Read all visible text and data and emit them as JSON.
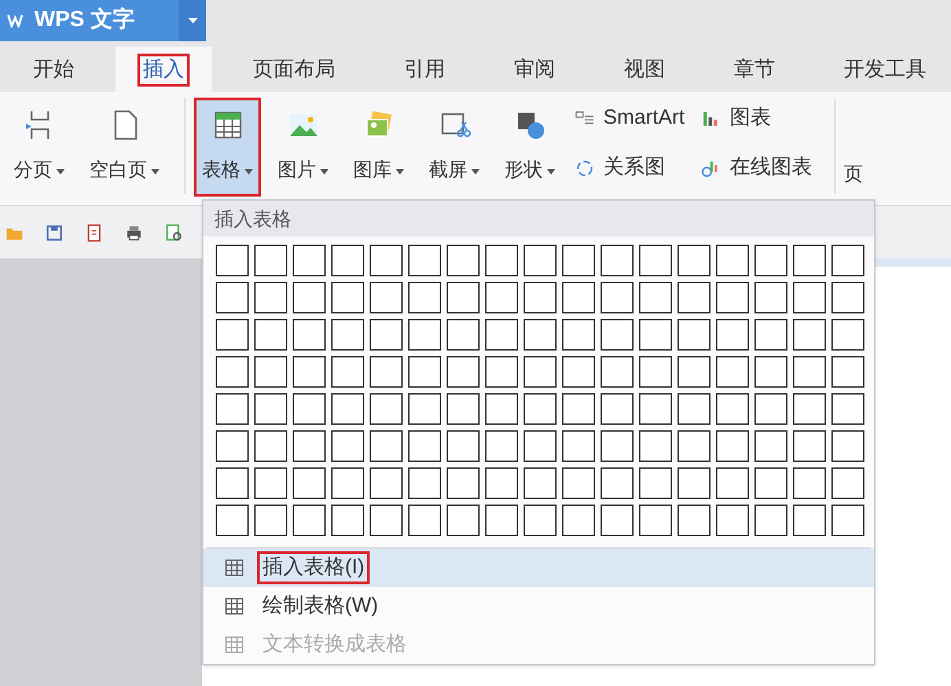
{
  "app_title": "WPS 文字",
  "tabs": [
    {
      "label": "开始",
      "selected": false
    },
    {
      "label": "插入",
      "selected": true
    },
    {
      "label": "页面布局",
      "selected": false
    },
    {
      "label": "引用",
      "selected": false
    },
    {
      "label": "审阅",
      "selected": false
    },
    {
      "label": "视图",
      "selected": false
    },
    {
      "label": "章节",
      "selected": false
    },
    {
      "label": "开发工具",
      "selected": false
    }
  ],
  "ribbon": [
    {
      "kind": "large",
      "label": "分页",
      "selected": false
    },
    {
      "kind": "large",
      "label": "空白页",
      "selected": false
    },
    {
      "kind": "separator"
    },
    {
      "kind": "large",
      "label": "表格",
      "selected": true
    },
    {
      "kind": "large",
      "label": "图片",
      "selected": false
    },
    {
      "kind": "large",
      "label": "图库",
      "selected": false
    },
    {
      "kind": "large",
      "label": "截屏",
      "selected": false
    },
    {
      "kind": "large",
      "label": "形状",
      "selected": false
    },
    {
      "kind": "small",
      "top": {
        "label": "SmartArt"
      },
      "bottom": {
        "label": "关系图"
      }
    },
    {
      "kind": "small",
      "top": {
        "label": "图表"
      },
      "bottom": {
        "label": "在线图表"
      }
    },
    {
      "kind": "separator"
    },
    {
      "kind": "cut",
      "label": "页"
    }
  ],
  "menu": {
    "header": "插入表格",
    "items": [
      {
        "label": "插入表格(I)",
        "selected": true,
        "disabled": false
      },
      {
        "label": "绘制表格(W)",
        "selected": false,
        "disabled": false
      },
      {
        "label": "文本转换成表格",
        "selected": false,
        "disabled": true
      }
    ]
  }
}
